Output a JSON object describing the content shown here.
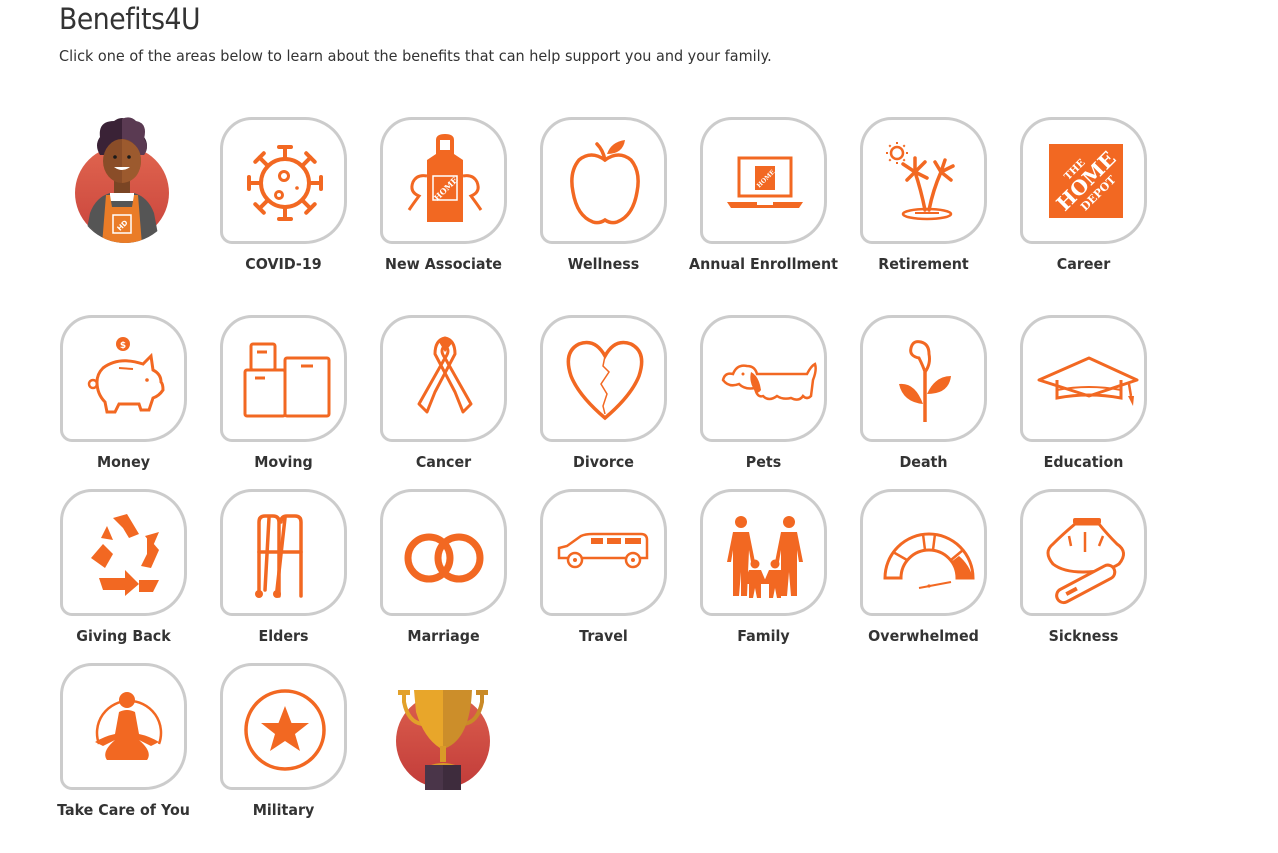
{
  "page": {
    "title": "Benefits4U",
    "subtitle": "Click one of the areas below to learn about the benefits that can help support you and your family."
  },
  "colors": {
    "accent": "#f26822",
    "tile_border": "#cccccc",
    "text": "#333333"
  },
  "decorations": {
    "associate_avatar": "associate-avatar",
    "trophy_badge": "trophy-badge"
  },
  "tiles": [
    {
      "label": "COVID-19",
      "icon": "virus-icon"
    },
    {
      "label": "New Associate",
      "icon": "apron-icon"
    },
    {
      "label": "Wellness",
      "icon": "apple-icon"
    },
    {
      "label": "Annual Enrollment",
      "icon": "laptop-icon"
    },
    {
      "label": "Retirement",
      "icon": "palm-island-icon"
    },
    {
      "label": "Career",
      "icon": "home-depot-logo-icon"
    },
    {
      "label": "Money",
      "icon": "piggy-bank-icon"
    },
    {
      "label": "Moving",
      "icon": "boxes-icon"
    },
    {
      "label": "Cancer",
      "icon": "ribbon-icon"
    },
    {
      "label": "Divorce",
      "icon": "broken-heart-icon"
    },
    {
      "label": "Pets",
      "icon": "dog-icon"
    },
    {
      "label": "Death",
      "icon": "lily-flower-icon"
    },
    {
      "label": "Education",
      "icon": "graduation-cap-icon"
    },
    {
      "label": "Giving Back",
      "icon": "recycle-icon"
    },
    {
      "label": "Elders",
      "icon": "walker-icon"
    },
    {
      "label": "Marriage",
      "icon": "rings-icon"
    },
    {
      "label": "Travel",
      "icon": "car-icon"
    },
    {
      "label": "Family",
      "icon": "family-icon"
    },
    {
      "label": "Overwhelmed",
      "icon": "gauge-icon"
    },
    {
      "label": "Sickness",
      "icon": "ice-pack-thermometer-icon"
    },
    {
      "label": "Take Care of You",
      "icon": "meditation-icon"
    },
    {
      "label": "Military",
      "icon": "star-circle-icon"
    }
  ]
}
